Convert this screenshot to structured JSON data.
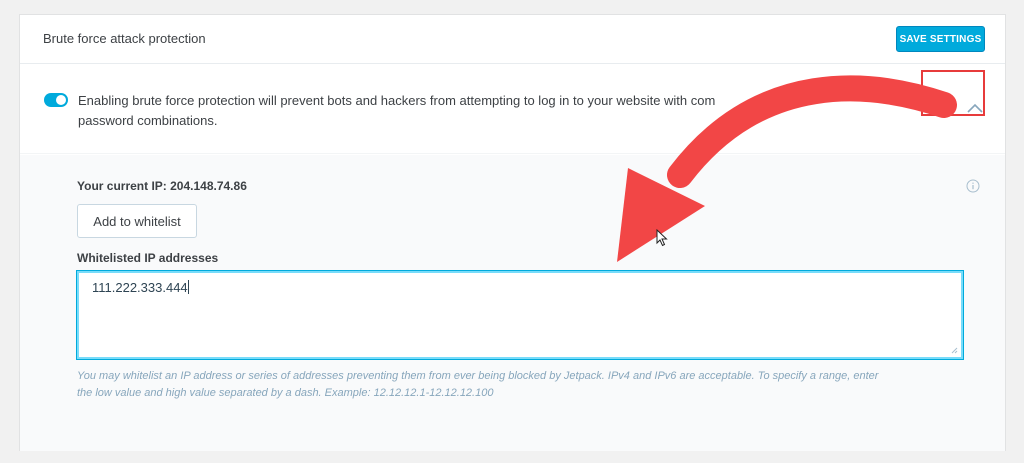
{
  "header": {
    "title": "Brute force attack protection",
    "save_label": "SAVE SETTINGS"
  },
  "protection": {
    "enabled": true,
    "description": "Enabling brute force protection will prevent bots and hackers from attempting to log in to your website with com",
    "description_line2": "password combinations."
  },
  "whitelist": {
    "current_ip_label": "Your current IP: 204.148.74.86",
    "add_button_label": "Add to whitelist",
    "field_label": "Whitelisted IP addresses",
    "field_value": "111.222.333.444",
    "help_text_line1": "You may whitelist an IP address or series of addresses preventing them from ever being blocked by Jetpack. IPv4 and IPv6 are acceptable. To specify a range, enter",
    "help_text_line2": "the low value and high value separated by a dash. Example: 12.12.12.1-12.12.12.100"
  },
  "icons": {
    "collapse": "chevron-up-icon",
    "info": "info-icon",
    "annotation": "red-curved-arrow"
  },
  "colors": {
    "accent": "#00aadc",
    "annotation": "#e73b3b"
  }
}
